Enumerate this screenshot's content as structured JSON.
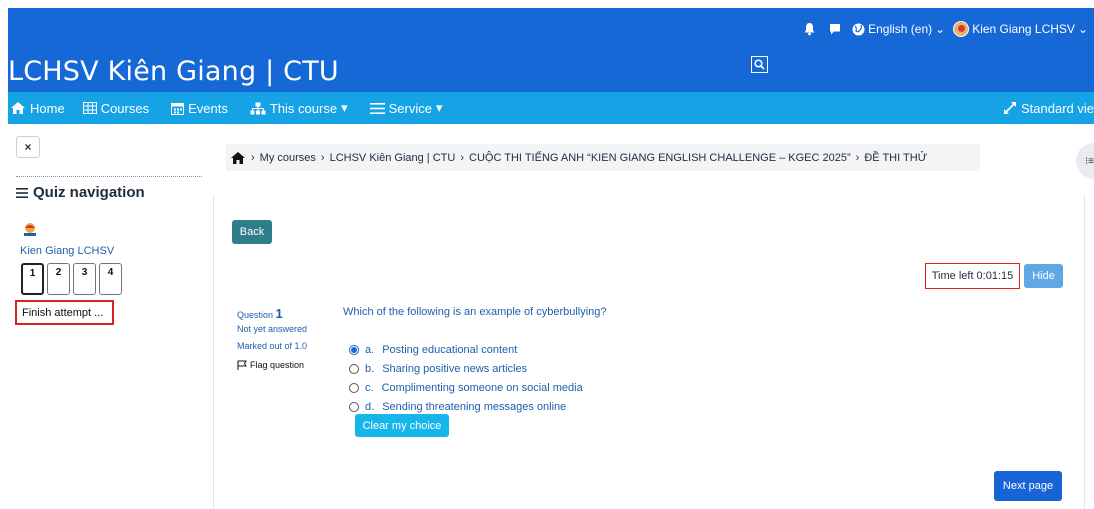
{
  "topbar": {
    "icons": [
      "bell-icon",
      "chat-icon",
      "globe-icon"
    ],
    "language": "English (en)",
    "user_name": "Kien Giang LCHSV"
  },
  "site": {
    "title": "LCHSV Kiên Giang | CTU"
  },
  "nav": {
    "home": "Home",
    "courses": "Courses",
    "events": "Events",
    "this_course": "This course",
    "service": "Service",
    "standard_view": "Standard vie"
  },
  "drawer": {
    "close_label": "×",
    "title": "Quiz navigation",
    "user_name": "Kien Giang LCHSV",
    "questions": [
      "1",
      "2",
      "3",
      "4"
    ],
    "current_question": "1",
    "finish_attempt": "Finish attempt ..."
  },
  "breadcrumb": {
    "items": [
      "My courses",
      "LCHSV Kiên Giang | CTU",
      "CUỘC THI TIẾNG ANH “KIEN GIANG ENGLISH CHALLENGE – KGEC 2025”",
      "ĐỀ THI THỬ"
    ]
  },
  "quiz": {
    "back_label": "Back",
    "timer_text": "Time left 0:01:15",
    "hide_label": "Hide",
    "question_label": "Question",
    "question_number": "1",
    "state": "Not yet answered",
    "marked_out": "Marked out of 1.0",
    "flag_label": "Flag question",
    "question_text": "Which of the following is an example of cyberbullying?",
    "answers": [
      {
        "letter": "a.",
        "text": "Posting educational content",
        "selected": true
      },
      {
        "letter": "b.",
        "text": "Sharing positive news articles",
        "selected": false
      },
      {
        "letter": "c.",
        "text": "Complimenting someone on social media",
        "selected": false
      },
      {
        "letter": "d.",
        "text": "Sending threatening messages online",
        "selected": false
      }
    ],
    "clear_label": "Clear my choice",
    "next_label": "Next page"
  },
  "colors": {
    "header_blue": "#1568d6",
    "nav_cyan": "#16a3e6",
    "link_blue": "#1f5fae",
    "highlight_red": "#d82323"
  }
}
